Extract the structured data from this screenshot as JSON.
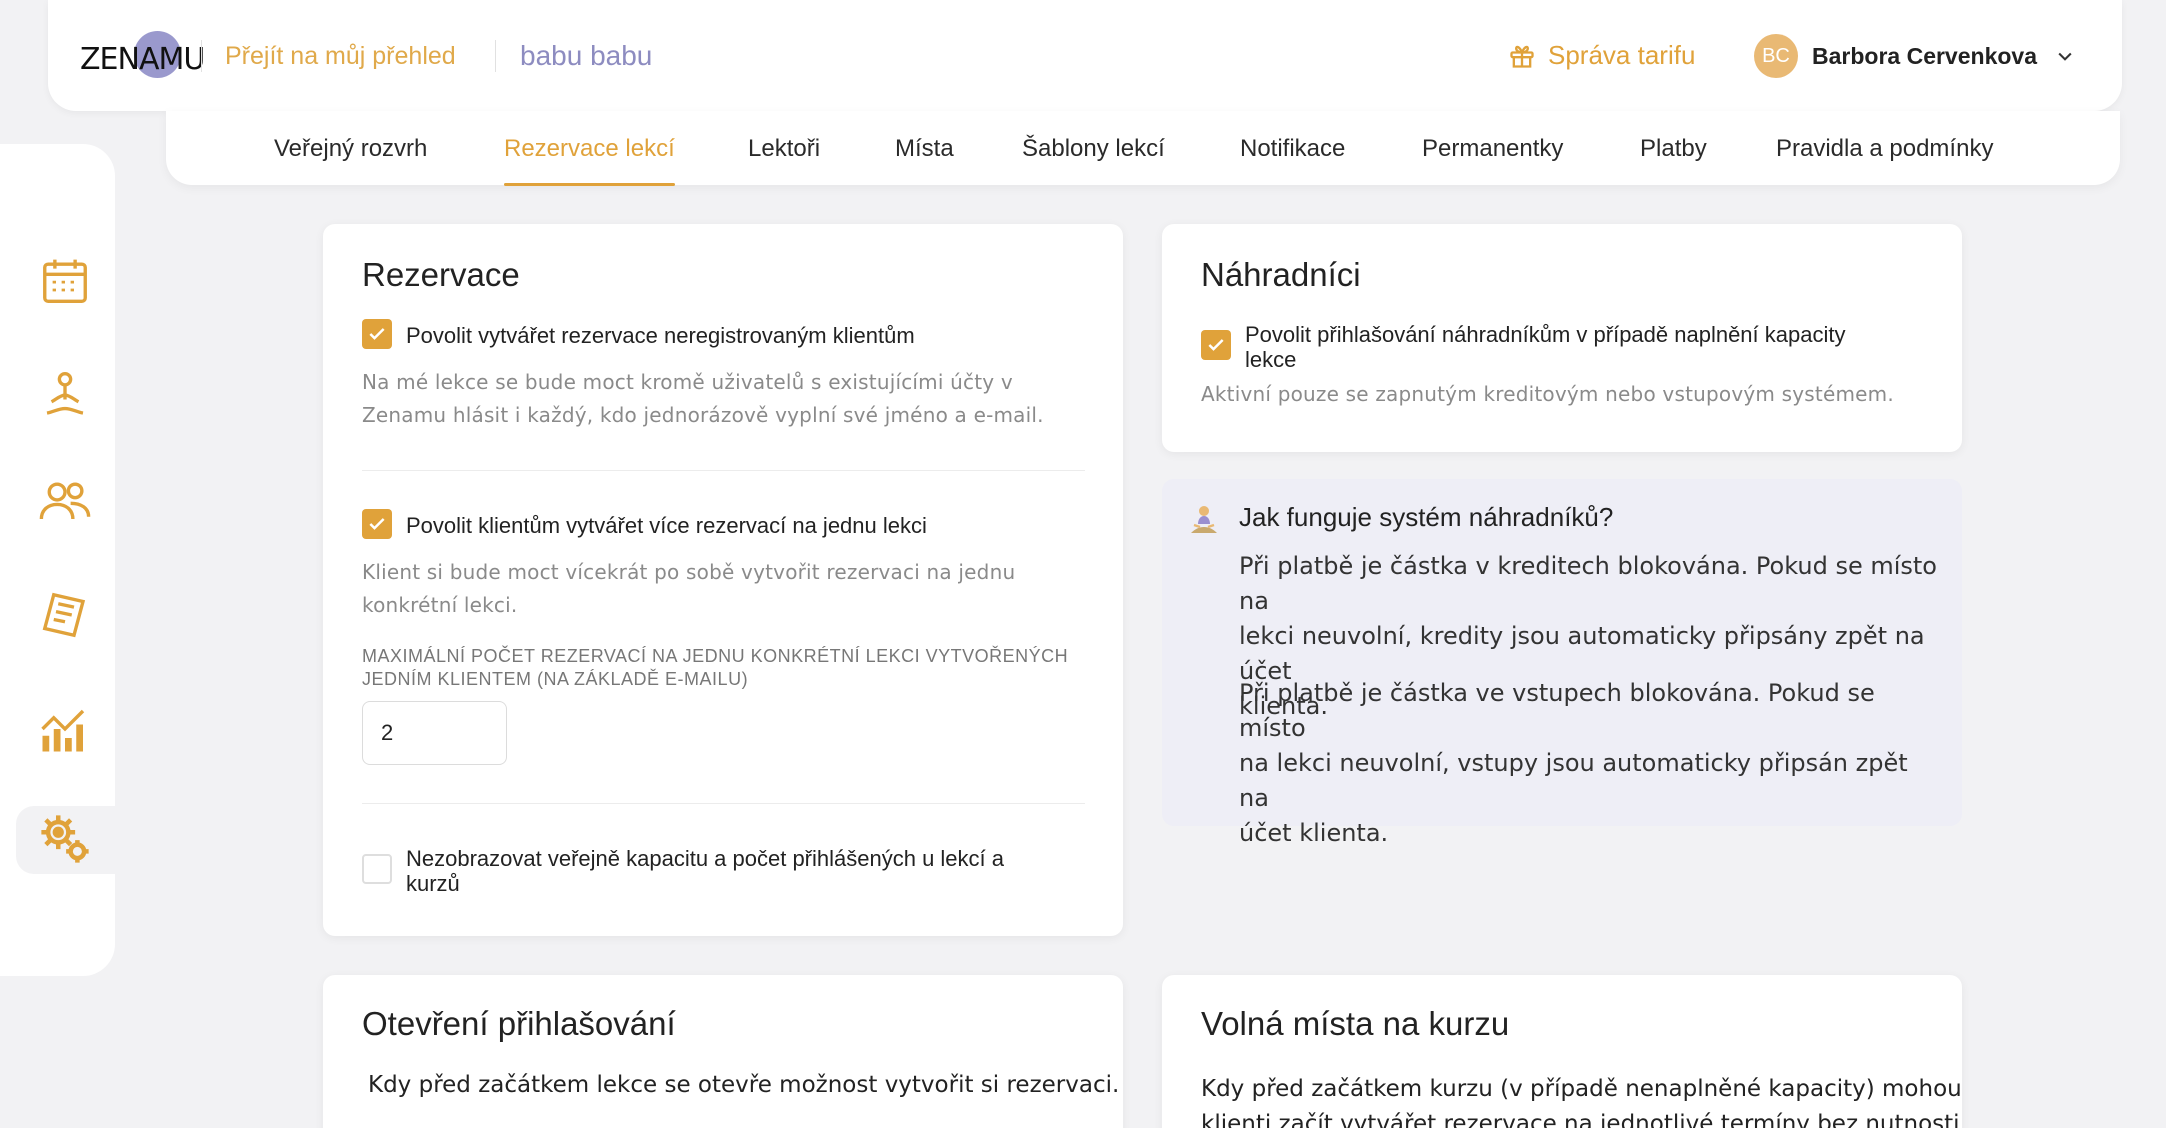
{
  "header": {
    "logo_text": "ZENAMU",
    "overview_link": "Přejít na můj přehled",
    "school_name": "babu babu",
    "tariff_label": "Správa tarifu",
    "user": {
      "initials": "BC",
      "name": "Barbora Cervenkova"
    }
  },
  "tabs": [
    {
      "label": "Veřejný rozvrh"
    },
    {
      "label": "Rezervace lekcí",
      "active": true
    },
    {
      "label": "Lektoři"
    },
    {
      "label": "Místa"
    },
    {
      "label": "Šablony lekcí"
    },
    {
      "label": "Notifikace"
    },
    {
      "label": "Permanentky"
    },
    {
      "label": "Platby"
    },
    {
      "label": "Pravidla a podmínky"
    }
  ],
  "sidebar": {
    "items": [
      {
        "icon": "calendar-icon"
      },
      {
        "icon": "yoga-icon"
      },
      {
        "icon": "users-icon"
      },
      {
        "icon": "document-icon"
      },
      {
        "icon": "chart-icon"
      },
      {
        "icon": "settings-icon",
        "active": true
      }
    ]
  },
  "reservations": {
    "title": "Rezervace",
    "opt1_label": "Povolit vytvářet rezervace neregistrovaným klientům",
    "opt1_checked": true,
    "opt1_help_1": "Na mé lekce se bude moct kromě uživatelů s existujícími účty v",
    "opt1_help_2": "Zenamu hlásit i každý, kdo jednorázově vyplní své jméno a e-mail.",
    "opt2_label": "Povolit klientům vytvářet více rezervací na jednu lekci",
    "opt2_checked": true,
    "opt2_help_1": "Klient si bude moct vícekrát po sobě vytvořit rezervaci na jednu",
    "opt2_help_2": "konkrétní lekci.",
    "max_label_1": "MAXIMÁLNÍ POČET REZERVACÍ NA JEDNU KONKRÉTNÍ LEKCI VYTVOŘENÝCH",
    "max_label_2": "JEDNÍM KLIENTEM (NA ZÁKLADĚ E-MAILU)",
    "max_value": "2",
    "opt3_label_1": "Nezobrazovat veřejně kapacitu a počet přihlášených u lekcí a",
    "opt3_label_2": "kurzů",
    "opt3_checked": false
  },
  "substitutes": {
    "title": "Náhradníci",
    "opt_label_1": "Povolit přihlašování náhradníkům v případě naplnění kapacity",
    "opt_label_2": "lekce",
    "opt_checked": true,
    "help": "Aktivní pouze se zapnutým kreditovým nebo vstupovým systémem."
  },
  "info_box": {
    "title": "Jak funguje systém náhradníků?",
    "p1_1": "Při platbě je částka v kreditech blokována. Pokud se místo na",
    "p1_2": "lekci neuvolní, kredity jsou automaticky připsány zpět na účet",
    "p1_3": "klienta.",
    "p2_1": "Při platbě je částka ve vstupech blokována. Pokud se místo",
    "p2_2": "na lekci neuvolní, vstupy jsou automaticky připsán zpět na",
    "p2_3": "účet klienta."
  },
  "opening": {
    "title": "Otevření přihlašování",
    "text": "Kdy před začátkem lekce se otevře možnost vytvořit si rezervaci."
  },
  "free_spots": {
    "title": "Volná místa na kurzu",
    "text_1": "Kdy před začátkem kurzu (v případě nenaplněné kapacity) mohou",
    "text_2": "klienti začít vytvářet rezervace na jednotlivé termíny bez nutnosti"
  },
  "colors": {
    "accent": "#e0a23a",
    "brand_purple": "#8d8cc0",
    "background": "#f2f2f4",
    "info_bg": "#eeeef6"
  }
}
